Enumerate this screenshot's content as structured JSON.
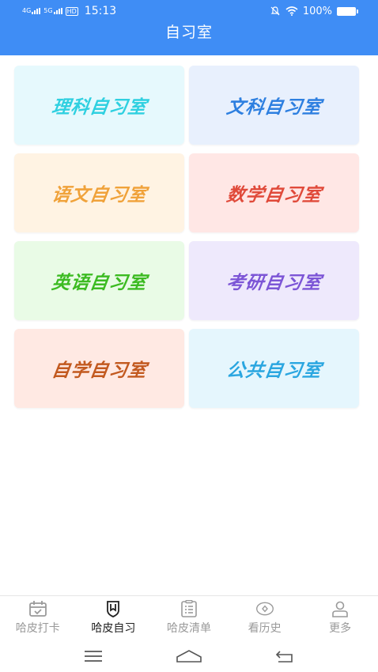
{
  "status": {
    "sig1": "4G",
    "sig2": "5G",
    "hd": "HD",
    "time": "15:13",
    "battery": "100%"
  },
  "header": {
    "title": "自习室"
  },
  "rooms": [
    {
      "label": "理科自习室",
      "bg": "#e6f9fd",
      "color": "#2fd0e0"
    },
    {
      "label": "文科自习室",
      "bg": "#e8f0fd",
      "color": "#2d7fe0"
    },
    {
      "label": "语文自习室",
      "bg": "#fff3e3",
      "color": "#f0a23a"
    },
    {
      "label": "数学自习室",
      "bg": "#ffe7e5",
      "color": "#e04a3a"
    },
    {
      "label": "英语自习室",
      "bg": "#e9fbe6",
      "color": "#3cbb22"
    },
    {
      "label": "考研自习室",
      "bg": "#eee9fc",
      "color": "#7c55d6"
    },
    {
      "label": "自学自习室",
      "bg": "#ffe9e3",
      "color": "#c2591f"
    },
    {
      "label": "公共自习室",
      "bg": "#e5f6fd",
      "color": "#2aa6e0"
    }
  ],
  "tabs": [
    {
      "label": "哈皮打卡",
      "icon": "calendar-check-icon",
      "active": false
    },
    {
      "label": "哈皮自习",
      "icon": "shield-book-icon",
      "active": true
    },
    {
      "label": "哈皮清单",
      "icon": "clipboard-list-icon",
      "active": false
    },
    {
      "label": "看历史",
      "icon": "eye-icon",
      "active": false
    },
    {
      "label": "更多",
      "icon": "person-icon",
      "active": false
    }
  ]
}
